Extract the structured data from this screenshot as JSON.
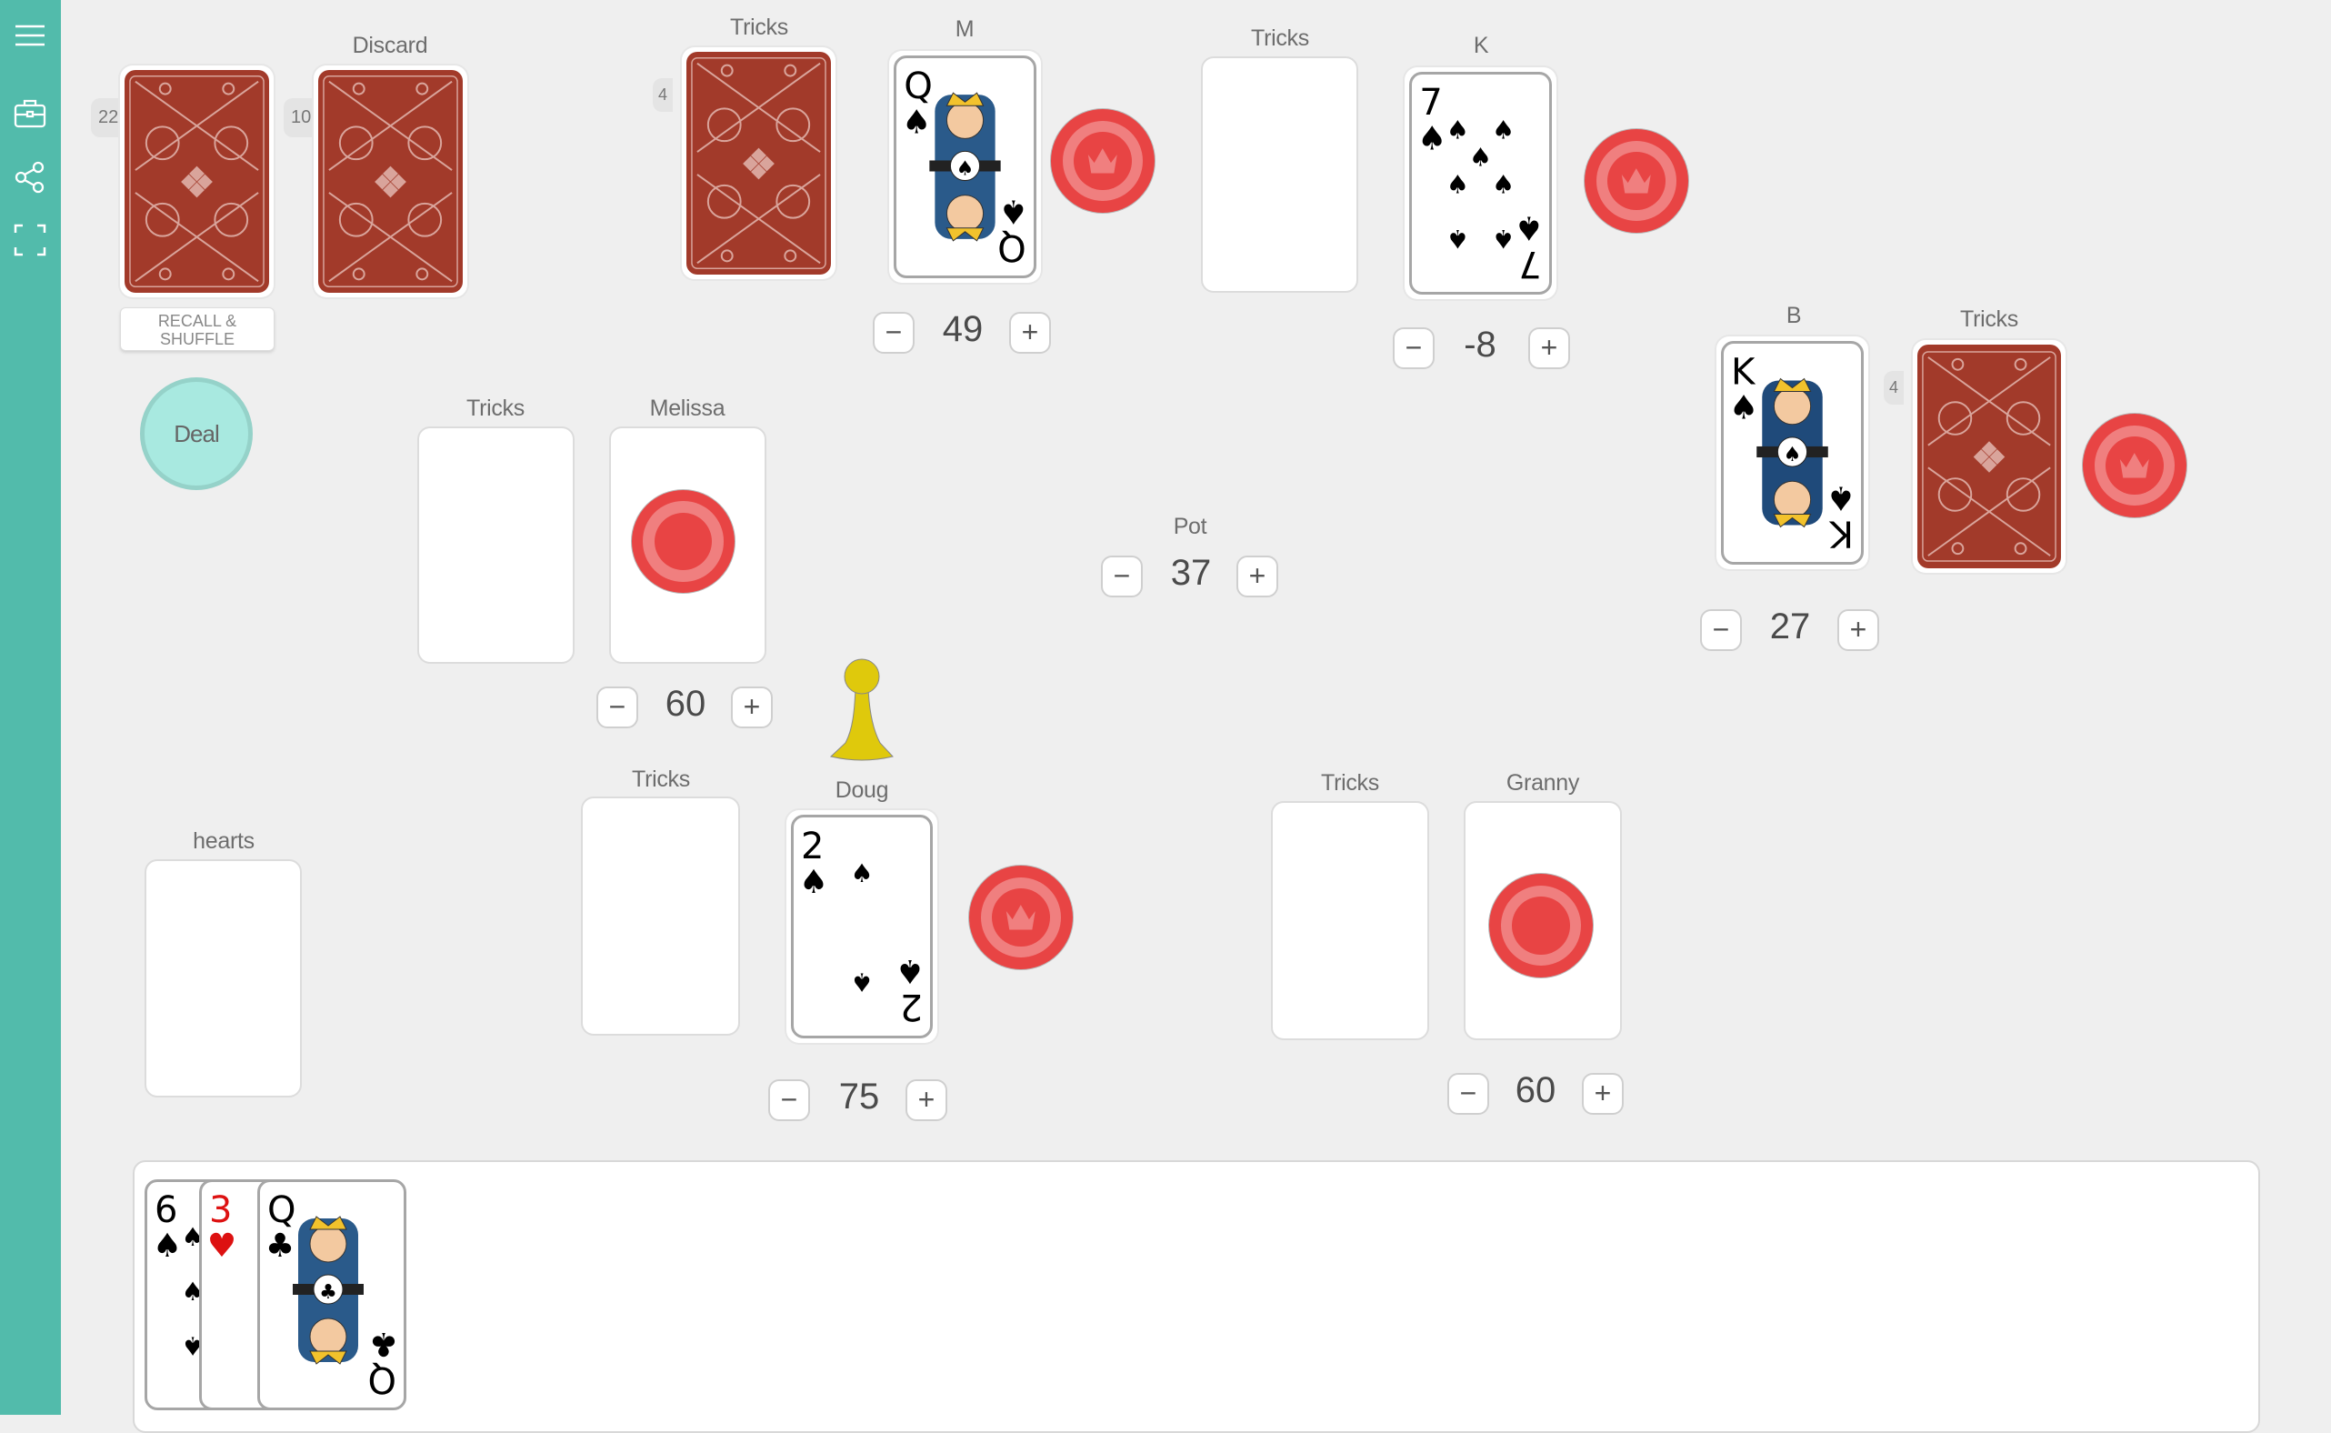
{
  "sidebar": {
    "items": [
      {
        "name": "menu",
        "icon": "hamburger-menu-icon"
      },
      {
        "name": "toolbox",
        "icon": "briefcase-icon"
      },
      {
        "name": "share",
        "icon": "share-icon"
      },
      {
        "name": "fullscreen",
        "icon": "fullscreen-icon"
      }
    ]
  },
  "deck": {
    "count": "22",
    "recall_label_1": "RECALL &",
    "recall_label_2": "SHUFFLE"
  },
  "discard": {
    "label": "Discard",
    "count": "10"
  },
  "deal_label": "Deal",
  "players": {
    "m": {
      "name": "M",
      "tricks_label": "Tricks",
      "tricks_count": "4",
      "card": {
        "rank": "Q",
        "suit": "♠"
      },
      "score": "49",
      "chip": "crown"
    },
    "k": {
      "name": "K",
      "tricks_label": "Tricks",
      "card": {
        "rank": "7",
        "suit": "♠"
      },
      "score": "-8",
      "chip": "crown"
    },
    "b": {
      "name": "B",
      "tricks_label": "Tricks",
      "tricks_count": "4",
      "card": {
        "rank": "K",
        "suit": "♠"
      },
      "score": "27",
      "chip": "crown"
    },
    "melissa": {
      "name": "Melissa",
      "tricks_label": "Tricks",
      "score": "60",
      "chip": "plain"
    },
    "doug": {
      "name": "Doug",
      "tricks_label": "Tricks",
      "card": {
        "rank": "2",
        "suit": "♠"
      },
      "score": "75",
      "chip": "crown"
    },
    "granny": {
      "name": "Granny",
      "tricks_label": "Tricks",
      "score": "60",
      "chip": "plain"
    }
  },
  "pot": {
    "label": "Pot",
    "value": "37"
  },
  "hearts_label": "hearts",
  "counter": {
    "minus": "−",
    "plus": "+"
  },
  "hand": [
    {
      "rank": "6",
      "suit": "♠",
      "color": "#000000"
    },
    {
      "rank": "3",
      "suit": "♥",
      "color": "#dd1111"
    },
    {
      "rank": "Q",
      "suit": "♣",
      "color": "#000000"
    }
  ],
  "colors": {
    "sidebar": "#52bbab",
    "card_back": "#a23a2a",
    "chip": "#e84444",
    "chip_ring": "#f07f7f",
    "deal": "#a8e9e0",
    "pawn": "#dfc90c"
  }
}
